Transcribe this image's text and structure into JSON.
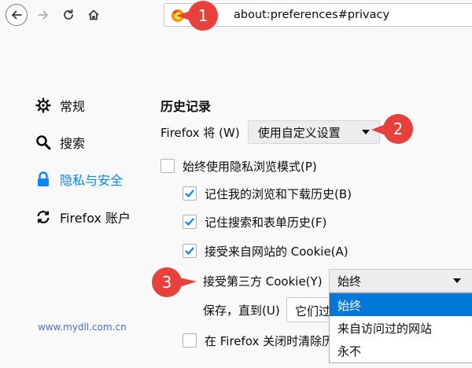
{
  "browser": {
    "url": "about:preferences#privacy",
    "icons": [
      "back-icon",
      "forward-icon",
      "reload-icon",
      "home-icon",
      "firefox-icon"
    ]
  },
  "sidebar": {
    "items": [
      {
        "label": "常规",
        "icon": "gear-icon"
      },
      {
        "label": "搜索",
        "icon": "search-icon"
      },
      {
        "label": "隐私与安全",
        "icon": "lock-icon",
        "active": true
      },
      {
        "label": "Firefox 账户",
        "icon": "sync-icon"
      }
    ]
  },
  "history": {
    "title": "历史记录",
    "firefox_will_label": "Firefox 将 (W)",
    "firefox_will_value": "使用自定义设置",
    "always_private": {
      "label": "始终使用隐私浏览模式(P)",
      "checked": false
    },
    "remember_history": {
      "label": "记住我的浏览和下载历史(B)",
      "checked": true
    },
    "remember_search": {
      "label": "记住搜索和表单历史(F)",
      "checked": true
    },
    "accept_cookies": {
      "label": "接受来自网站的 Cookie(A)",
      "checked": true
    },
    "third_party_label": "接受第三方 Cookie(Y)",
    "third_party_value": "始终",
    "third_party_options": [
      "始终",
      "来自访问过的网站",
      "永不"
    ],
    "keep_until_label": "保存，直到(U)",
    "keep_until_value": "它们过期",
    "clear_on_close": {
      "label": "在 Firefox 关闭时清除历史",
      "checked": false
    }
  },
  "callouts": [
    "1",
    "2",
    "3"
  ],
  "watermark": "www.mydll.com.cn",
  "colors": {
    "accent": "#0a84ff",
    "callout": "#e8413c",
    "selected": "#0078d7"
  }
}
